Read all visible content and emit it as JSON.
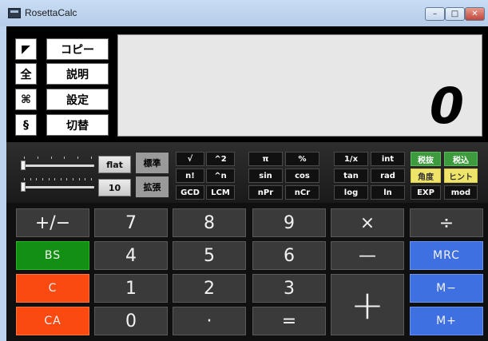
{
  "window": {
    "title": "RosettaCalc",
    "controls": {
      "minimize": "–",
      "maximize": "□",
      "close": "✕"
    }
  },
  "left_buttons": [
    {
      "icon": "◤",
      "label": "コピー",
      "icon_name": "corner-icon"
    },
    {
      "icon": "全",
      "label": "説明"
    },
    {
      "icon": "⌘",
      "label": "設定",
      "icon_name": "command-icon"
    },
    {
      "icon": "§",
      "label": "切替"
    }
  ],
  "display": {
    "value": "0"
  },
  "sliders": [
    {
      "level": 0
    },
    {
      "level": 0
    }
  ],
  "options": {
    "format": "flat",
    "digits": "10",
    "mode_standard": "標準",
    "mode_extended": "拡張"
  },
  "function_keys": [
    [
      "√",
      "^2",
      "π",
      "%",
      "1/x",
      "int"
    ],
    [
      "n!",
      "^n",
      "sin",
      "cos",
      "tan",
      "rad"
    ],
    [
      "GCD",
      "LCM",
      "nPr",
      "nCr",
      "log",
      "ln"
    ]
  ],
  "right_keys": {
    "tax_ex": "税抜",
    "tax_in": "税込",
    "angle": "角度",
    "hint": "ヒント",
    "exp": "EXP",
    "mod": "mod"
  },
  "keypad": {
    "sign": "+/−",
    "bs": "BS",
    "c": "C",
    "ca": "CA",
    "n7": "7",
    "n8": "8",
    "n9": "9",
    "n4": "4",
    "n5": "5",
    "n6": "6",
    "n1": "1",
    "n2": "2",
    "n3": "3",
    "n0": "0",
    "dot": "·",
    "equals": "=",
    "multiply": "×",
    "divide": "÷",
    "minus": "—",
    "plus": "+",
    "mrc": "MRC",
    "m_minus": "M−",
    "m_plus": "M+"
  },
  "colors": {
    "green": "#138f13",
    "orange": "#fb4a10",
    "blue": "#3e70e2",
    "tax_green": "#3d9a3d",
    "yellow": "#efe46a"
  }
}
